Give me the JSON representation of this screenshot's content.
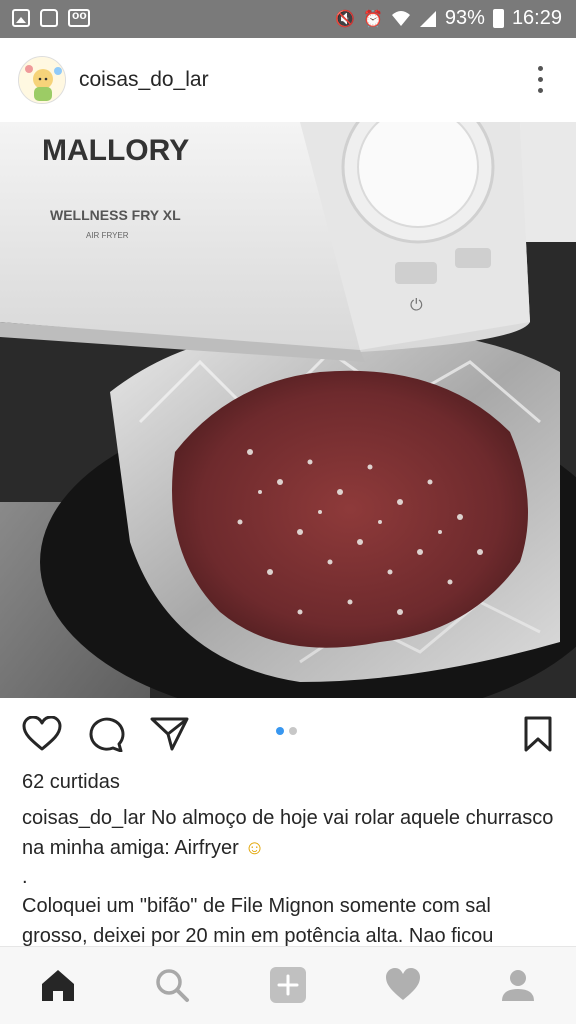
{
  "status_bar": {
    "battery": "93%",
    "time": "16:29",
    "icons": [
      "image-icon",
      "shopping-bag-icon",
      "voicemail-icon",
      "mute-icon",
      "alarm-icon",
      "wifi-icon",
      "signal-icon",
      "battery-icon"
    ]
  },
  "post": {
    "username": "coisas_do_lar",
    "more_icon": "more-vertical-icon",
    "photo": {
      "brand_text": "MALLORY",
      "model_text": "WELLNESS FRY XL",
      "sub_text": "AIR FRYER"
    },
    "likes_label": "62 curtidas",
    "caption": {
      "username": "coisas_do_lar",
      "line1": "No almoço de hoje vai rolar aquele churrasco na minha amiga: Airfryer",
      "emoji": "☺",
      "dot": ".",
      "line2": "Coloquei um \"bifão\" de File Mignon somente com sal grosso, deixei por 20 min em potência alta. Nao ficou"
    },
    "carousel": {
      "count": 2,
      "active": 1
    }
  },
  "bottom_nav": {
    "items": [
      "home-icon",
      "search-icon",
      "add-icon",
      "heart-icon",
      "profile-icon"
    ]
  },
  "colors": {
    "status_bar": "#7a7a7a",
    "accent_dot": "#3897f0",
    "text": "#262626"
  }
}
